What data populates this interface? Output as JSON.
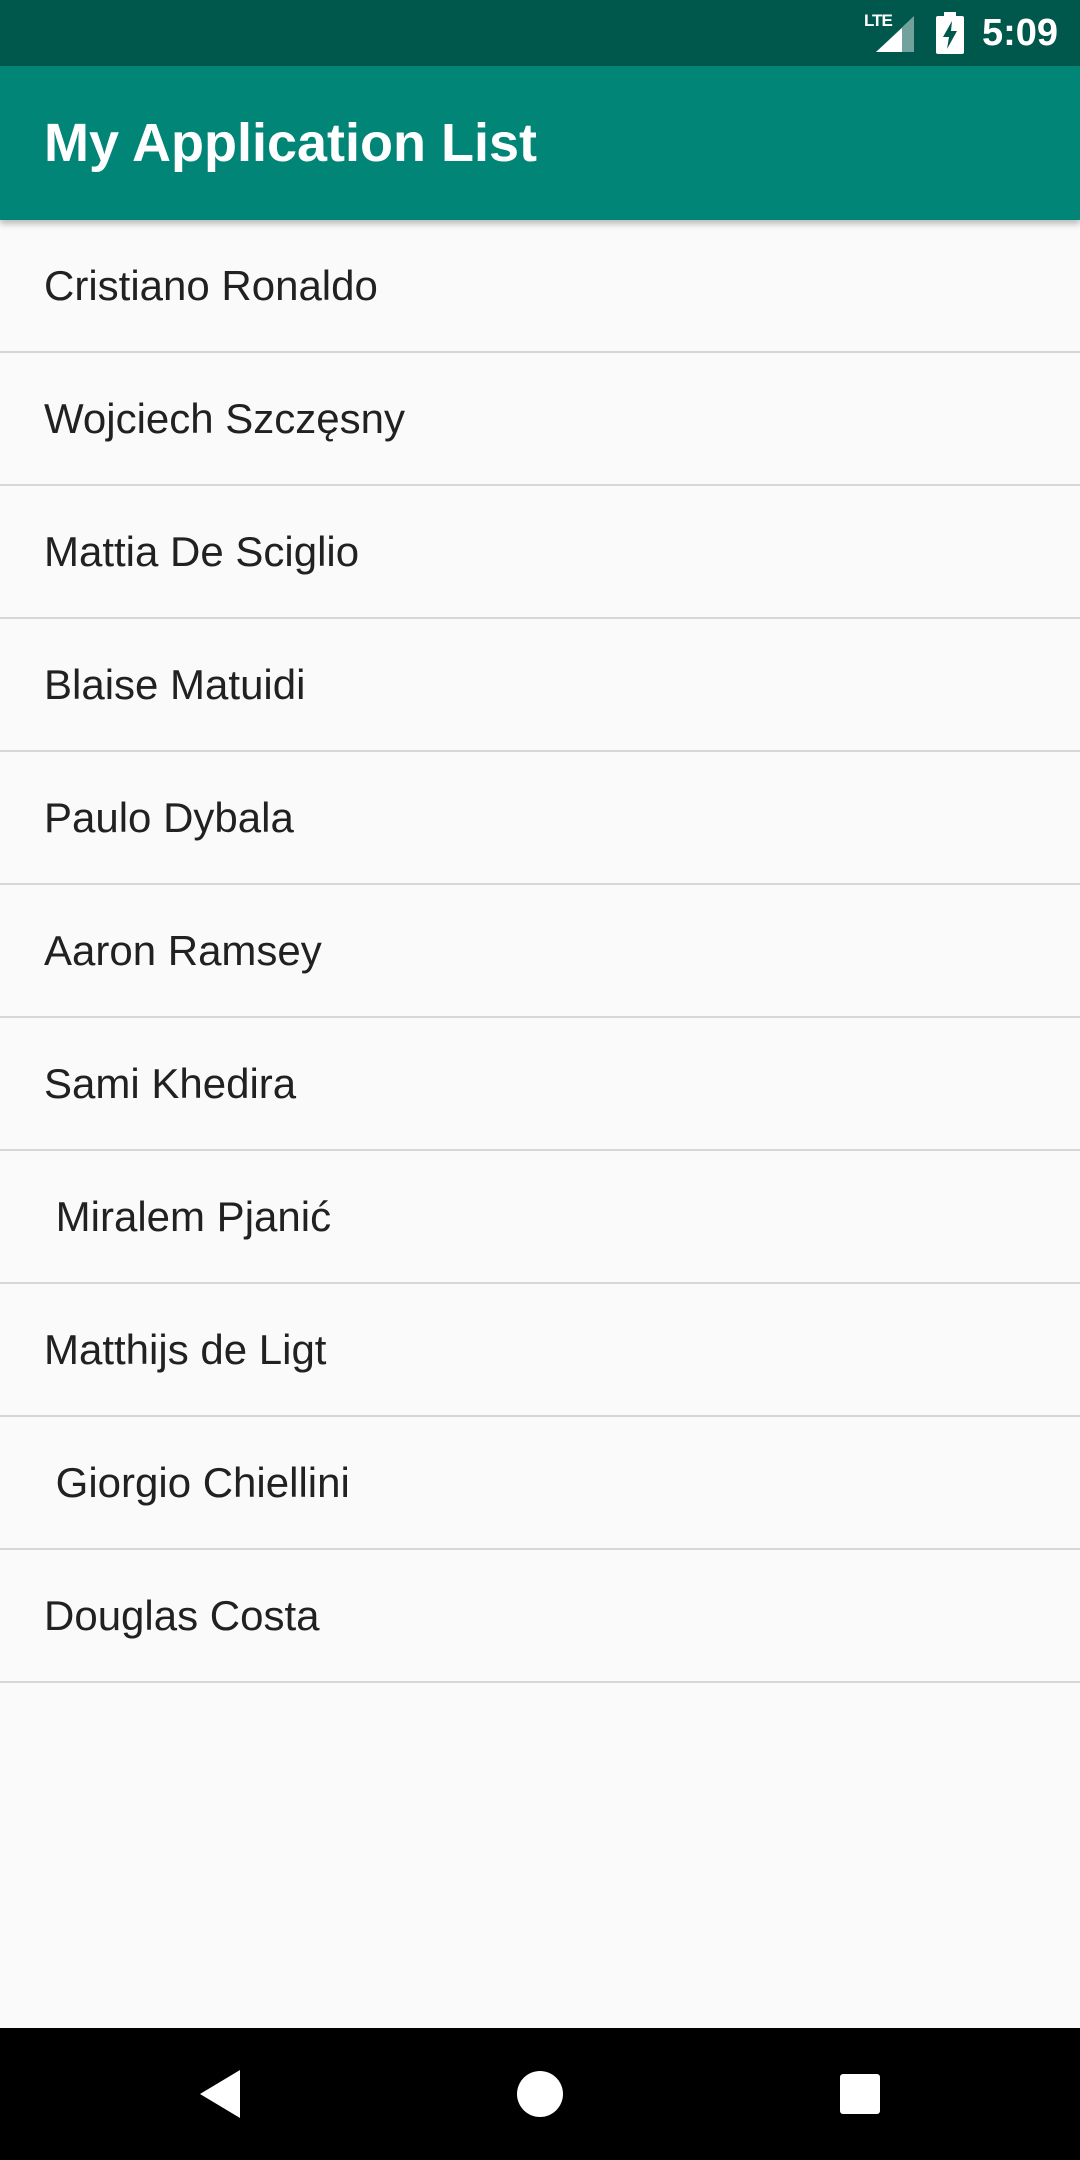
{
  "status_bar": {
    "network_label": "LTE",
    "time": "5:09",
    "icons": [
      "lte-signal-icon",
      "battery-charging-icon"
    ]
  },
  "app_bar": {
    "title": "My Application List",
    "color": "#008577"
  },
  "list": {
    "items": [
      "Cristiano Ronaldo",
      "Wojciech Szczęsny",
      "Mattia De Sciglio",
      "Blaise Matuidi",
      "Paulo Dybala",
      "Aaron Ramsey",
      "Sami Khedira",
      " Miralem Pjanić",
      "Matthijs de Ligt",
      " Giorgio Chiellini",
      "Douglas Costa"
    ]
  },
  "nav_bar": {
    "icons": [
      "back-icon",
      "home-icon",
      "recents-icon"
    ]
  }
}
